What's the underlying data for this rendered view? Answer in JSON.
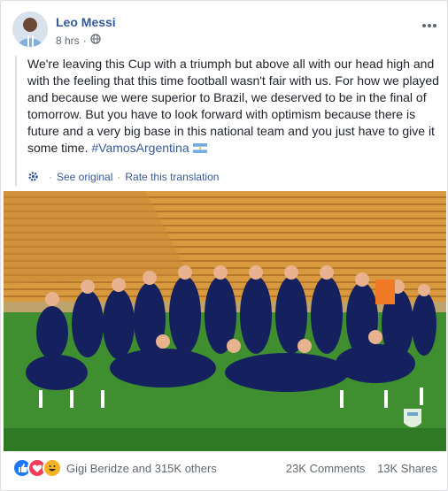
{
  "post": {
    "author": "Leo Messi",
    "time": "8 hrs",
    "privacy_icon": "globe-icon",
    "more_icon": "more-dots-icon",
    "text": "We're leaving this Cup with a triumph but above all with our head high and with the feeling that this time football wasn't fair with us. For how we played and because we were superior to Brazil, we deserved to be in the final of tomorrow. But you have to look forward with optimism because there is future and a very big base in this national team and you just have to give it some time.",
    "hashtag": "#VamosArgentina",
    "flag_icon": "argentina-flag-icon",
    "see_original": "See original",
    "rate_translation": "Rate this translation"
  },
  "footer": {
    "reaction_icons": [
      "like-icon",
      "love-icon",
      "haha-icon"
    ],
    "likers": "Gigi Beridze and 315K others",
    "comments": "23K Comments",
    "shares": "13K Shares"
  },
  "colors": {
    "link": "#385898",
    "author": "#365899",
    "text": "#1d2129",
    "muted": "#616770",
    "like": "#2078f4",
    "love": "#f33e58",
    "haha": "#f7b125"
  }
}
